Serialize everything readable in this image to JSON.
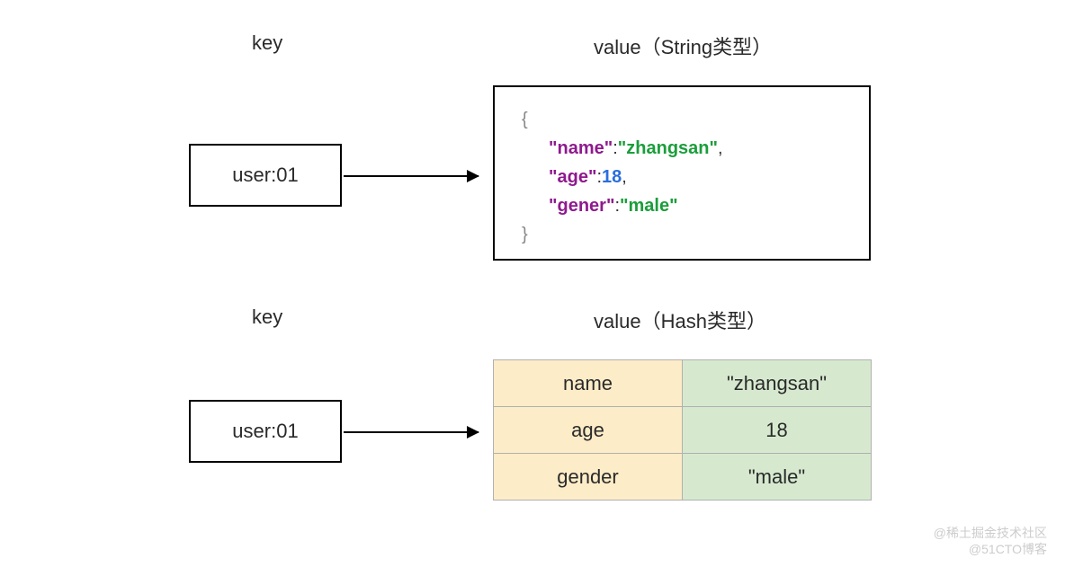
{
  "section1": {
    "key_header": "key",
    "value_header": "value（String类型）",
    "key_text": "user:01",
    "json": {
      "open": "{",
      "close": "}",
      "k1": "\"name\"",
      "c1": ":",
      "v1": "\"zhangsan\"",
      "comma1": ",",
      "k2": "\"age\"",
      "c2": ":",
      "v2": "18",
      "comma2": ",",
      "k3": "\"gener\"",
      "c3": ":",
      "v3": "\"male\""
    }
  },
  "section2": {
    "key_header": "key",
    "value_header": "value（Hash类型）",
    "key_text": "user:01",
    "hash": {
      "rows": [
        {
          "field": "name",
          "value": "\"zhangsan\""
        },
        {
          "field": "age",
          "value": "18"
        },
        {
          "field": "gender",
          "value": "\"male\""
        }
      ]
    }
  },
  "watermark1": "@稀土掘金技术社区",
  "watermark2": "@51CTO博客"
}
